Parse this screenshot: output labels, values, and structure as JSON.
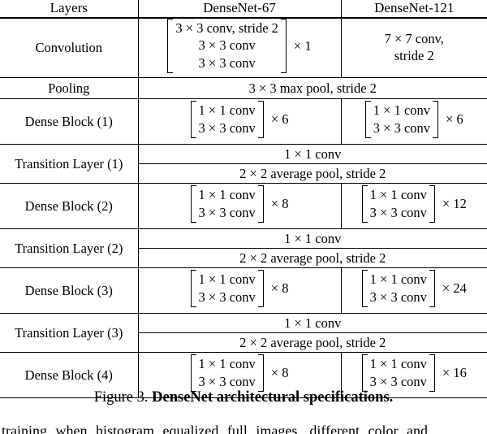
{
  "table": {
    "headers": [
      "Layers",
      "DenseNet-67",
      "DenseNet-121"
    ],
    "rows": [
      {
        "layer": "Convolution",
        "kind": "split",
        "d67": {
          "type": "bracket",
          "lines": [
            "3 × 3 conv, stride 2",
            "3 × 3 conv",
            "3 × 3 conv"
          ],
          "repeat": "× 1"
        },
        "d121": {
          "type": "text",
          "lines": [
            "7 × 7 conv,",
            "stride 2"
          ]
        }
      },
      {
        "layer": "Pooling",
        "kind": "span",
        "span_text": "3 × 3 max pool, stride 2"
      },
      {
        "layer": "Dense Block (1)",
        "kind": "split",
        "d67": {
          "type": "bracket",
          "lines": [
            "1 × 1 conv",
            "3 × 3 conv"
          ],
          "repeat": "× 6"
        },
        "d121": {
          "type": "bracket",
          "lines": [
            "1 × 1 conv",
            "3 × 3 conv"
          ],
          "repeat": "× 6"
        }
      },
      {
        "layer": "Transition Layer (1)",
        "kind": "transition",
        "sub": [
          "1 × 1 conv",
          "2 × 2 average pool, stride 2"
        ]
      },
      {
        "layer": "Dense Block (2)",
        "kind": "split",
        "d67": {
          "type": "bracket",
          "lines": [
            "1 × 1 conv",
            "3 × 3 conv"
          ],
          "repeat": "× 8"
        },
        "d121": {
          "type": "bracket",
          "lines": [
            "1 × 1 conv",
            "3 × 3 conv"
          ],
          "repeat": "× 12"
        }
      },
      {
        "layer": "Transition Layer (2)",
        "kind": "transition",
        "sub": [
          "1 × 1 conv",
          "2 × 2 average pool, stride 2"
        ]
      },
      {
        "layer": "Dense Block (3)",
        "kind": "split",
        "d67": {
          "type": "bracket",
          "lines": [
            "1 × 1 conv",
            "3 × 3 conv"
          ],
          "repeat": "× 8"
        },
        "d121": {
          "type": "bracket",
          "lines": [
            "1 × 1 conv",
            "3 × 3 conv"
          ],
          "repeat": "× 24"
        }
      },
      {
        "layer": "Transition Layer (3)",
        "kind": "transition",
        "sub": [
          "1 × 1 conv",
          "2 × 2 average pool, stride 2"
        ]
      },
      {
        "layer": "Dense Block (4)",
        "kind": "split",
        "d67": {
          "type": "bracket",
          "lines": [
            "1 × 1 conv",
            "3 × 3 conv"
          ],
          "repeat": "× 8"
        },
        "d121": {
          "type": "bracket",
          "lines": [
            "1 × 1 conv",
            "3 × 3 conv"
          ],
          "repeat": "× 16"
        }
      }
    ]
  },
  "caption": {
    "number": "Figure 3.",
    "title": "DenseNet architectural specifications."
  },
  "body_text": {
    "cropped_line": "training when histogram equalized full images, different color and"
  }
}
